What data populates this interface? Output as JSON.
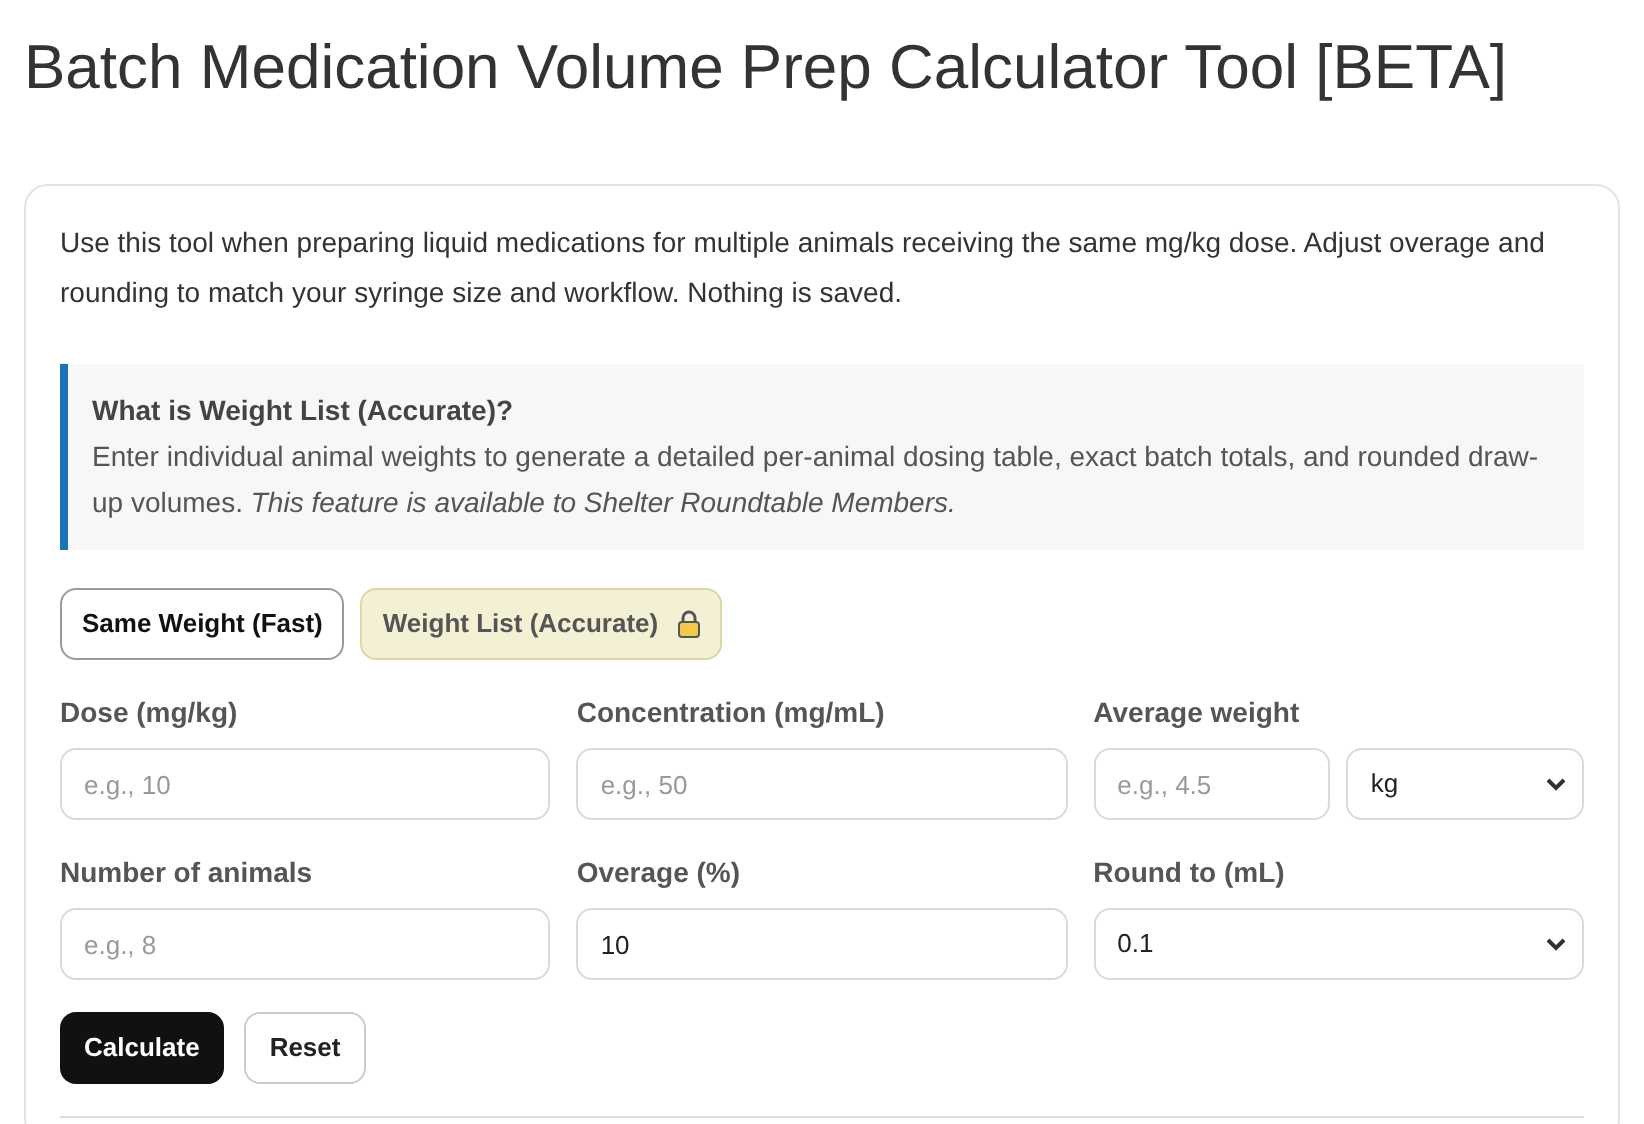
{
  "title": "Batch Medication Volume Prep Calculator Tool [BETA]",
  "intro": "Use this tool when preparing liquid medications for multiple animals receiving the same mg/kg dose. Adjust overage and rounding to match your syringe size and workflow. Nothing is saved.",
  "callout": {
    "heading": "What is Weight List (Accurate)?",
    "body": "Enter individual animal weights to generate a detailed per-animal dosing table, exact batch totals, and rounded draw-up volumes. *This feature is available to Shelter Roundtable Members.*"
  },
  "modes": [
    {
      "label": "Same Weight (Fast)",
      "selected": true,
      "locked": false
    },
    {
      "label": "Weight List (Accurate)",
      "selected": false,
      "locked": true
    }
  ],
  "fields": [
    {
      "kind": "text",
      "label": "Dose (mg/kg)",
      "placeholder": "e.g., 10"
    },
    {
      "kind": "text",
      "label": "Concentration (mg/mL)",
      "placeholder": "e.g., 50"
    },
    {
      "kind": "text_with_unit",
      "label": "Average weight",
      "placeholder": "e.g., 4.5",
      "unit": "kg"
    },
    {
      "kind": "text",
      "label": "Number of animals",
      "placeholder": "e.g., 8"
    },
    {
      "kind": "text",
      "label": "Overage (%)",
      "value": "10"
    },
    {
      "kind": "select",
      "label": "Round to (mL)",
      "value": "0.1"
    }
  ],
  "buttons": [
    {
      "label": "Calculate",
      "kind": "primary"
    },
    {
      "label": "Reset",
      "kind": "secondary"
    }
  ]
}
